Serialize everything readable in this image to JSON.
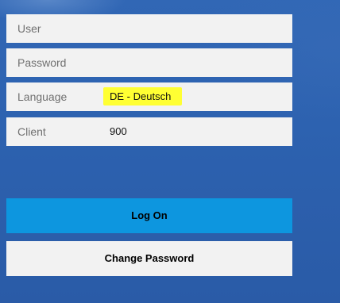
{
  "form": {
    "user": {
      "placeholder": "User",
      "value": ""
    },
    "password": {
      "placeholder": "Password",
      "value": ""
    },
    "language": {
      "label": "Language",
      "value": "DE - Deutsch"
    },
    "client": {
      "label": "Client",
      "value": "900"
    }
  },
  "buttons": {
    "log_on": "Log On",
    "change_password": "Change Password"
  },
  "colors": {
    "background": "#2c5fae",
    "field_background": "#f2f2f2",
    "primary_button": "#0d96df",
    "highlight": "#ffff33"
  }
}
